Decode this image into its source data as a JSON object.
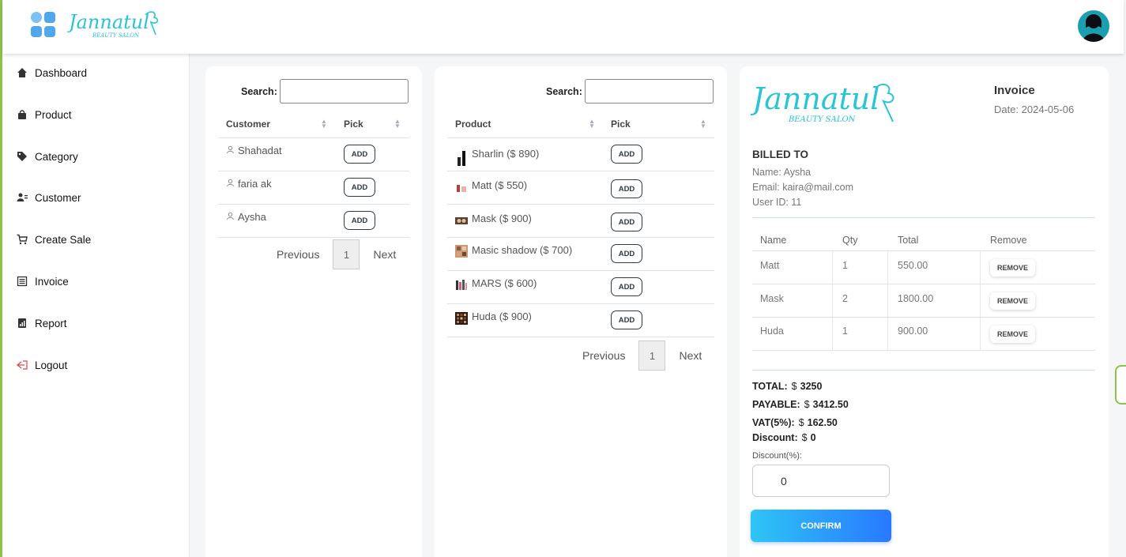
{
  "brand": {
    "name": "Jannatul",
    "tagline": "BEAUTY SALON"
  },
  "sidebar": {
    "items": [
      {
        "label": "Dashboard",
        "icon": "home-icon"
      },
      {
        "label": "Product",
        "icon": "bag-icon"
      },
      {
        "label": "Category",
        "icon": "tag-icon"
      },
      {
        "label": "Customer",
        "icon": "users-icon"
      },
      {
        "label": "Create Sale",
        "icon": "cart-icon"
      },
      {
        "label": "Invoice",
        "icon": "list-icon"
      },
      {
        "label": "Report",
        "icon": "report-icon"
      },
      {
        "label": "Logout",
        "icon": "logout-icon"
      }
    ]
  },
  "customers": {
    "search_label": "Search:",
    "search_value": "",
    "columns": {
      "name": "Customer",
      "pick": "Pick"
    },
    "rows": [
      {
        "name": "Shahadat",
        "action": "ADD"
      },
      {
        "name": "faria ak",
        "action": "ADD"
      },
      {
        "name": "Aysha",
        "action": "ADD"
      }
    ],
    "pager": {
      "prev": "Previous",
      "page": "1",
      "next": "Next"
    }
  },
  "products": {
    "search_label": "Search:",
    "search_value": "",
    "columns": {
      "name": "Product",
      "pick": "Pick"
    },
    "rows": [
      {
        "name": "Sharlin ($ 890)",
        "action": "ADD"
      },
      {
        "name": "Matt ($ 550)",
        "action": "ADD"
      },
      {
        "name": "Mask ($ 900)",
        "action": "ADD"
      },
      {
        "name": "Masic shadow ($ 700)",
        "action": "ADD"
      },
      {
        "name": "MARS ($ 600)",
        "action": "ADD"
      },
      {
        "name": "Huda ($ 900)",
        "action": "ADD"
      }
    ],
    "pager": {
      "prev": "Previous",
      "page": "1",
      "next": "Next"
    }
  },
  "invoice": {
    "title": "Invoice",
    "date": "Date: 2024-05-06",
    "billed_to": "BILLED TO",
    "name": "Name: Aysha",
    "email": "Email: kaira@mail.com",
    "user_id": "User ID: 11",
    "columns": {
      "name": "Name",
      "qty": "Qty",
      "total": "Total",
      "remove": "Remove"
    },
    "items": [
      {
        "name": "Matt",
        "qty": "1",
        "total": "550.00",
        "action": "REMOVE"
      },
      {
        "name": "Mask",
        "qty": "2",
        "total": "1800.00",
        "action": "REMOVE"
      },
      {
        "name": "Huda",
        "qty": "1",
        "total": "900.00",
        "action": "REMOVE"
      }
    ],
    "summary": {
      "total_label": "TOTAL:",
      "total": "3250",
      "payable_label": "PAYABLE:",
      "payable": "3412.50",
      "vat_label": "VAT(5%):",
      "vat": "162.50",
      "discount_label": "Discount:",
      "discount": "0",
      "currency": "$"
    },
    "discount_pct_label": "Discount(%):",
    "discount_pct_value": "0",
    "confirm_label": "CONFIRM"
  },
  "colors": {
    "accent_green": "#8bc34a",
    "brand_teal": "#29c4d6",
    "confirm_start": "#2ec5f5",
    "confirm_end": "#2979ff"
  }
}
